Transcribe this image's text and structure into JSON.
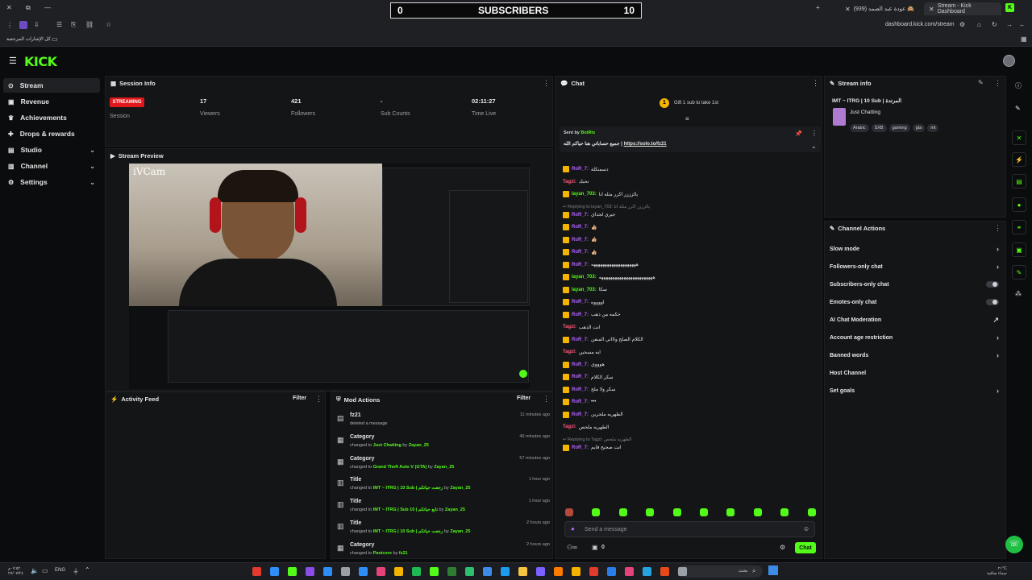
{
  "browser": {
    "tabs": [
      {
        "label": "(939) عودة عبد الصمد 🙈"
      },
      {
        "label": "Stream - Kick Dashboard"
      }
    ],
    "address": "dashboard.kick.com/stream",
    "bookmarks_label": "كل الإشارات المرجعية"
  },
  "overlay": {
    "left": "0",
    "title": "SUBSCRIBERS",
    "right": "10"
  },
  "app": {
    "logo": "KICK"
  },
  "sidebar": {
    "items": [
      {
        "label": "Stream",
        "icon": "broadcast-icon"
      },
      {
        "label": "Revenue",
        "icon": "wallet-icon"
      },
      {
        "label": "Achievements",
        "icon": "trophy-icon"
      },
      {
        "label": "Drops & rewards",
        "icon": "gift-icon"
      },
      {
        "label": "Studio",
        "icon": "studio-icon"
      },
      {
        "label": "Channel",
        "icon": "channel-icon"
      },
      {
        "label": "Settings",
        "icon": "gear-icon"
      }
    ]
  },
  "session": {
    "title": "Session Info",
    "status": "STREAMING",
    "status_label": "Session",
    "stats": [
      {
        "value": "17",
        "label": "Viewers"
      },
      {
        "value": "421",
        "label": "Followers"
      },
      {
        "value": "-",
        "label": "Sub Counts"
      },
      {
        "value": "02:11:27",
        "label": "Time Live"
      }
    ]
  },
  "preview": {
    "title": "Stream Preview",
    "cam_label": "iVCam"
  },
  "activity": {
    "title": "Activity Feed",
    "filter": "Filter"
  },
  "mod_actions": {
    "title": "Mod Actions",
    "filter": "Filter",
    "rows": [
      {
        "title": "fz21",
        "detail_pre": "deleted a message",
        "detail_value": "",
        "detail_by": "",
        "detail_user": "",
        "time": "11 minutes ago"
      },
      {
        "title": "Category",
        "detail_pre": "changed to ",
        "detail_value": "Just Chatting",
        "detail_by": " by ",
        "detail_user": "Zayan_25",
        "time": "46 minutes ago"
      },
      {
        "title": "Category",
        "detail_pre": "changed to ",
        "detail_value": "Grand Theft Auto V (GTA)",
        "detail_by": " by ",
        "detail_user": "Zayan_25",
        "time": "57 minutes ago"
      },
      {
        "title": "Title",
        "detail_pre": "changed to ",
        "detail_value": "IMT ~ ITRG | 10 Sub | رجعت حياتكم",
        "detail_by": " by ",
        "detail_user": "Zayan_25",
        "time": "1 hour ago"
      },
      {
        "title": "Title",
        "detail_pre": "changed to ",
        "detail_value": "IMT ~ ITRG | Sub 10 | تابع حياتكم",
        "detail_by": " by ",
        "detail_user": "Zayan_25",
        "time": "1 hour ago"
      },
      {
        "title": "Title",
        "detail_pre": "changed to ",
        "detail_value": "IMT ~ ITRG | 10 Sub | رجعت حياتكم",
        "detail_by": " by ",
        "detail_user": "Zayan_25",
        "time": "2 hours ago"
      },
      {
        "title": "Category",
        "detail_pre": "changed to ",
        "detail_value": "Panicore",
        "detail_by": " by ",
        "detail_user": "fz21",
        "time": "2 hours ago"
      }
    ]
  },
  "chat": {
    "title": "Chat",
    "gift_text": "Gift 1 sub to take 1st",
    "gift_count": "1",
    "pinned": {
      "sent_by": "Sent by",
      "bot": "BotRix",
      "text": "جميع حساباتي هنا حياكم الله |",
      "link": "https://solo.to/fz21"
    },
    "messages": [
      {
        "user": "RoR_7",
        "text": "دسمنكلة",
        "kind": "ror"
      },
      {
        "user": "Tagzi",
        "text": "تحبك",
        "kind": "tagzi"
      },
      {
        "user": "layan_703",
        "text": "يالزززر اكرر مثله انا",
        "kind": "layan"
      },
      {
        "user": "RoR_7",
        "text": "جيري لجداي",
        "kind": "ror",
        "reply": "Replying to layan_703: يالزززر اكرر مثله انا"
      },
      {
        "user": "RoR_7",
        "text": "👍🏼",
        "kind": "ror"
      },
      {
        "user": "RoR_7",
        "text": "👍🏼",
        "kind": "ror"
      },
      {
        "user": "RoR_7",
        "text": "👍🏼",
        "kind": "ror"
      },
      {
        "user": "RoR_7",
        "text": "ههههههههههههههههههههه",
        "kind": "ror"
      },
      {
        "user": "layan_703",
        "text": "ههههههههههههههههههههههههه",
        "kind": "layan"
      },
      {
        "user": "layan_703",
        "text": "سكا",
        "kind": "layan"
      },
      {
        "user": "RoR_7",
        "text": "اووووه",
        "kind": "ror"
      },
      {
        "user": "RoR_7",
        "text": "حكمه من ذهب",
        "kind": "ror"
      },
      {
        "user": "Tagzi",
        "text": "انت الذهب",
        "kind": "tagzi"
      },
      {
        "user": "RoR_7",
        "text": "الكلام الصلح ولااني المنفن",
        "kind": "ror"
      },
      {
        "user": "Tagzi",
        "text": "ايه مسحين",
        "kind": "tagzi"
      },
      {
        "user": "RoR_7",
        "text": "هوووي",
        "kind": "ror"
      },
      {
        "user": "RoR_7",
        "text": "سكر الكلام",
        "kind": "ror"
      },
      {
        "user": "RoR_7",
        "text": "سكر ولا ملح",
        "kind": "ror"
      },
      {
        "user": "RoR_7",
        "text": "•••",
        "kind": "ror"
      },
      {
        "user": "RoR_7",
        "text": "الطهريه ملحرين",
        "kind": "ror"
      },
      {
        "user": "Tagzi",
        "text": "الطهريه ملحص",
        "kind": "tagzi"
      },
      {
        "user": "RoR_7",
        "text": "انت صحيح قايم",
        "kind": "ror",
        "reply": "Replying to Tagzi: الطهريه ملحص"
      }
    ],
    "input_placeholder": "Send a message",
    "viewer_count": "0",
    "send_label": "Chat"
  },
  "stream_info": {
    "title": "Stream info",
    "stream_title": "IMT ~ ITRG | 10 Sub | المرتدة",
    "category": "Just Chatting",
    "tags": [
      "Arabic",
      "SXB",
      "gaming",
      "gta",
      "mt"
    ]
  },
  "channel_actions": {
    "title": "Channel Actions",
    "items": [
      {
        "label": "Slow mode",
        "control": "arrow"
      },
      {
        "label": "Followers-only chat",
        "control": "arrow"
      },
      {
        "label": "Subscribers-only chat",
        "control": "toggle"
      },
      {
        "label": "Emotes-only chat",
        "control": "toggle"
      },
      {
        "label": "AI Chat Moderation",
        "control": "external"
      },
      {
        "label": "Account age restriction",
        "control": "arrow"
      },
      {
        "label": "Banned words",
        "control": "arrow"
      },
      {
        "label": "Host Channel",
        "control": "none"
      },
      {
        "label": "Set goals",
        "control": "arrow"
      }
    ]
  },
  "taskbar": {
    "lang": "ENG",
    "search": "بحث",
    "clock_top": "٢١°C",
    "clock_bottom": "سماء صافية",
    "time": "٠٧:٥٢م",
    "date": "٢٧/٠٧/٢٤"
  },
  "colors": {
    "brand": "#53fc18",
    "live": "#e0171b",
    "ror": "#b362ff",
    "tagzi": "#ff5a7a"
  }
}
